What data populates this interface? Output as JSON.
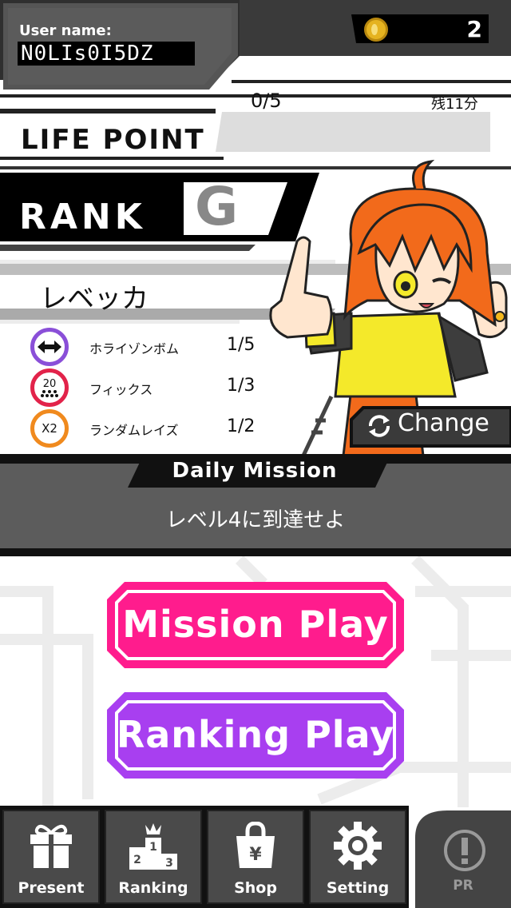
{
  "header": {
    "user_label": "User name:",
    "username": "N0LIs0I5DZ",
    "coin_count": "2"
  },
  "life": {
    "label": "LIFE POINT",
    "count": "0/5",
    "time_left": "残11分"
  },
  "rank": {
    "label": "RANK",
    "value": "G"
  },
  "character": {
    "name": "レベッカ",
    "change_label": "Change"
  },
  "skills": [
    {
      "icon": "double-arrow-icon",
      "icon_text": "",
      "name": "ホライゾンボム",
      "count": "1/5",
      "ring_color": "#8a4fd8"
    },
    {
      "icon": "twenty-dots-icon",
      "icon_text": "20",
      "name": "フィックス",
      "count": "1/3",
      "ring_color": "#e2234a"
    },
    {
      "icon": "x2-icon",
      "icon_text": "X2",
      "name": "ランダムレイズ",
      "count": "1/2",
      "ring_color": "#f08a1e"
    }
  ],
  "mission": {
    "title": "Daily Mission",
    "text": "レベル4に到達せよ"
  },
  "buttons": {
    "mission_play": "Mission Play",
    "ranking_play": "Ranking Play"
  },
  "nav": {
    "present": "Present",
    "ranking": "Ranking",
    "shop": "Shop",
    "setting": "Setting",
    "pr": "PR",
    "podium_digits": [
      "1",
      "2",
      "3"
    ],
    "shop_symbol": "¥"
  },
  "colors": {
    "mission_play": "#ff1c8d",
    "ranking_play": "#a83ff0",
    "hair": "#f26a1b",
    "shirt": "#f4e92a"
  }
}
